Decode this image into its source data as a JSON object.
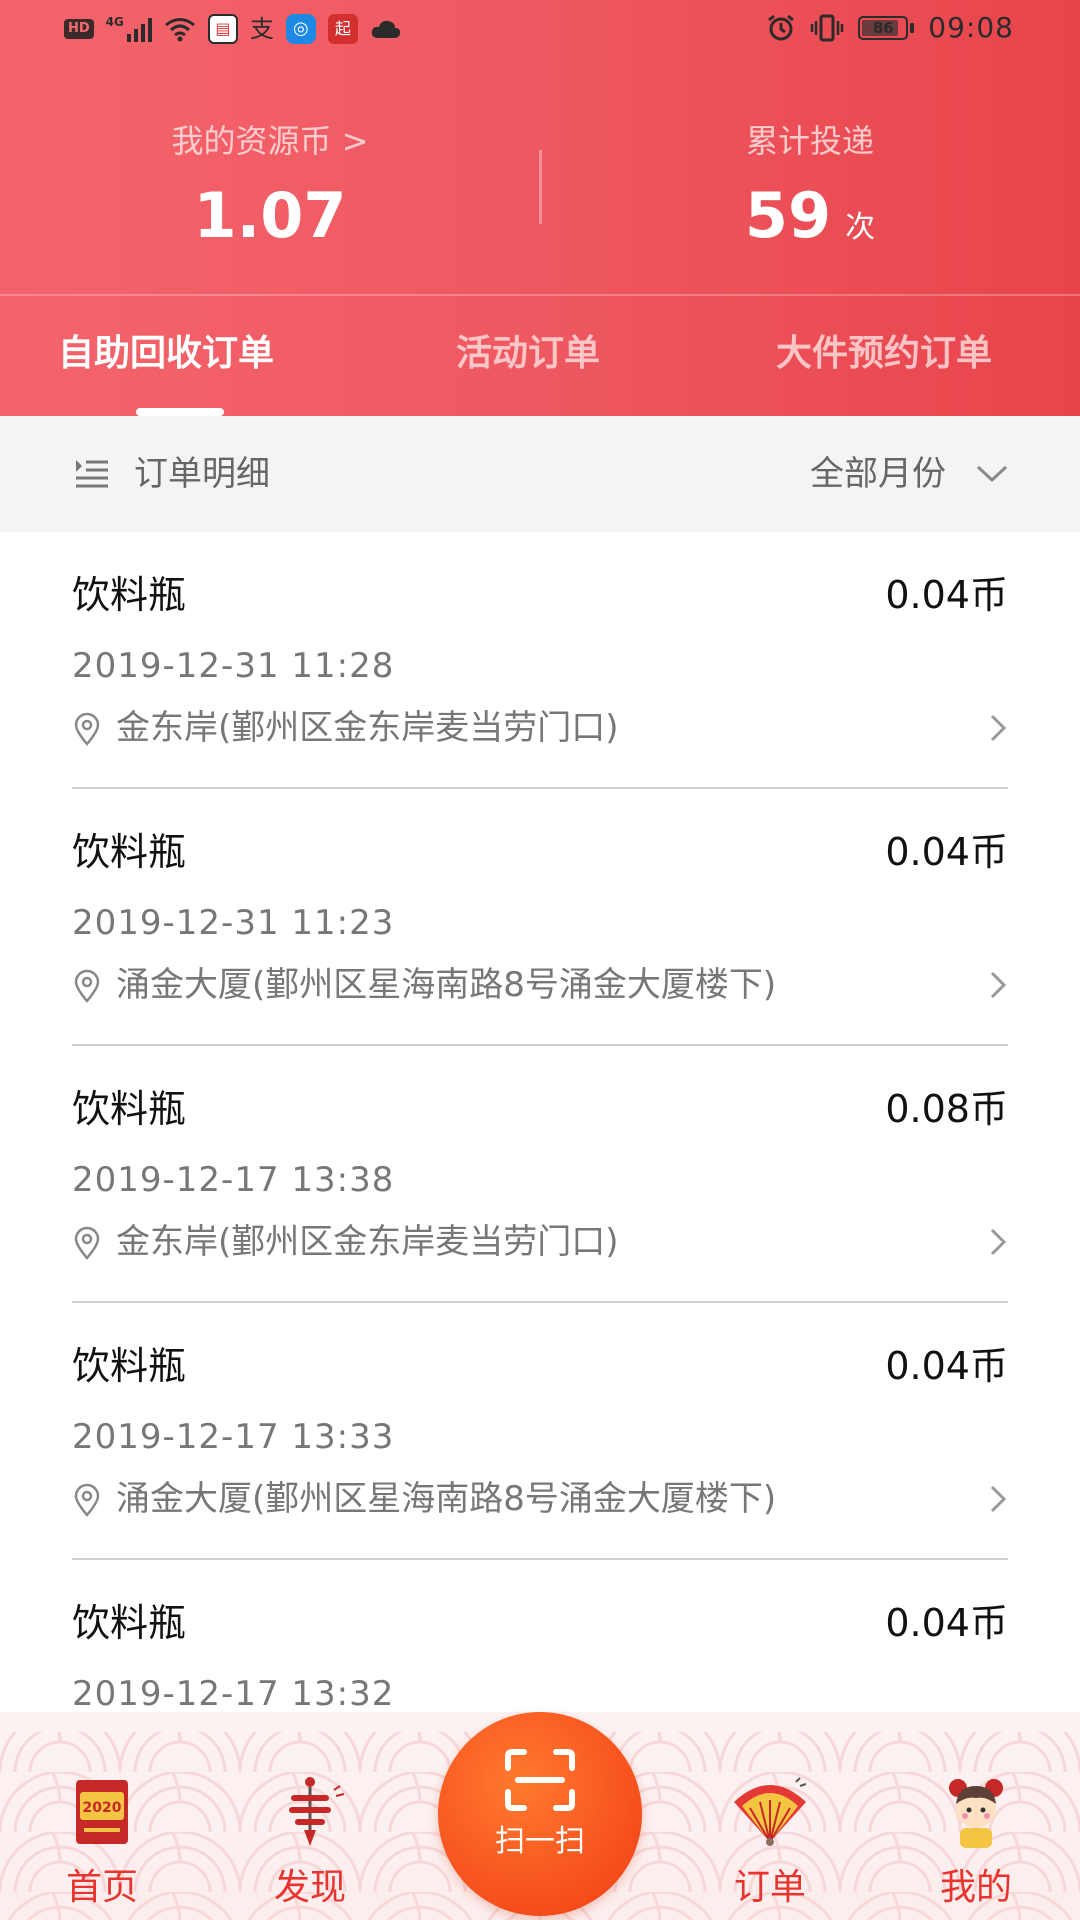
{
  "status_bar": {
    "left_badges": [
      "HD",
      "4G"
    ],
    "app_icons": [
      "reader-icon",
      "alipay-icon",
      "browser-icon",
      "qidian-icon",
      "cloud-icon"
    ],
    "battery": "86",
    "battery_level": 0.86,
    "time": "09:08"
  },
  "header": {
    "coins_label": "我的资源币  >",
    "coins_value": "1.07",
    "deliveries_label": "累计投递",
    "deliveries_value": "59",
    "deliveries_unit": "次"
  },
  "tabs": [
    {
      "label": "自助回收订单",
      "active": true
    },
    {
      "label": "活动订单",
      "active": false
    },
    {
      "label": "大件预约订单",
      "active": false
    }
  ],
  "filter": {
    "title": "订单明细",
    "month": "全部月份"
  },
  "orders": [
    {
      "name": "饮料瓶",
      "amount": "0.04币",
      "time": "2019-12-31 11:28",
      "location": "金东岸(鄞州区金东岸麦当劳门口)"
    },
    {
      "name": "饮料瓶",
      "amount": "0.04币",
      "time": "2019-12-31 11:23",
      "location": "涌金大厦(鄞州区星海南路8号涌金大厦楼下)"
    },
    {
      "name": "饮料瓶",
      "amount": "0.08币",
      "time": "2019-12-17 13:38",
      "location": "金东岸(鄞州区金东岸麦当劳门口)"
    },
    {
      "name": "饮料瓶",
      "amount": "0.04币",
      "time": "2019-12-17 13:33",
      "location": "涌金大厦(鄞州区星海南路8号涌金大厦楼下)"
    },
    {
      "name": "饮料瓶",
      "amount": "0.04币",
      "time": "2019-12-17 13:32",
      "location": ""
    }
  ],
  "bottom_nav": {
    "home": "首页",
    "discover": "发现",
    "scan": "扫一扫",
    "orders": "订单",
    "mine": "我的"
  },
  "colors": {
    "header_start": "#f4636c",
    "header_end": "#e8444b",
    "nav_label": "#e8332e",
    "scan_button": "#f7541f"
  }
}
